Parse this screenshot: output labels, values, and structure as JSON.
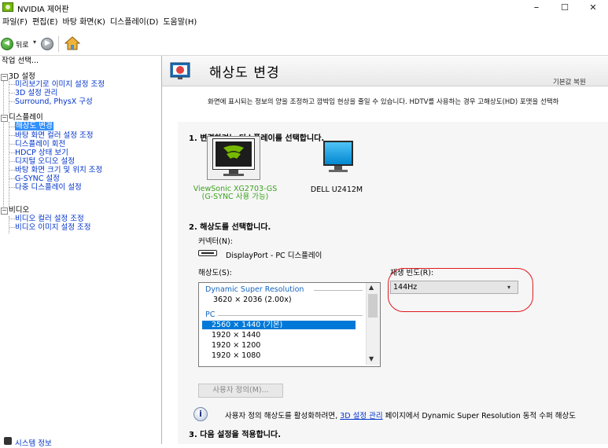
{
  "window": {
    "title": "NVIDIA 제어판",
    "minimize": "–",
    "maximize": "☐",
    "close": "✕"
  },
  "menu": [
    "파일(F)",
    "편집(E)",
    "바탕 화면(K)",
    "디스플레이(D)",
    "도움말(H)"
  ],
  "toolbar": {
    "back_label": "뒤로",
    "back_dropdown": "▾"
  },
  "sidebar": {
    "header": "작업 선택...",
    "groups": [
      {
        "label": "3D 설정",
        "items": [
          "미리보기로 이미지 설정 조정",
          "3D 설정 관리",
          "Surround, PhysX 구성"
        ]
      },
      {
        "label": "디스플레이",
        "items": [
          "해상도 변경",
          "바탕 화면 컬러 설정 조정",
          "디스플레이 회전",
          "HDCP 상태 보기",
          "디지털 오디오 설정",
          "바탕 화면 크기 및 위치 조정",
          "G-SYNC 설정",
          "다중 디스플레이 설정"
        ]
      },
      {
        "label": "비디오",
        "items": [
          "비디오 컬러 설정 조정",
          "비디오 이미지 설정 조정"
        ]
      }
    ],
    "selected": "해상도 변경",
    "system_info": "시스템 정보"
  },
  "page": {
    "title": "해상도 변경",
    "restore": "기본값 복원",
    "description": "화면에 표시되는 정보의 양을 조정하고 깜박임 현상을 줄일 수 있습니다. HDTV를 사용하는 경우 고해상도(HD) 포맷을 선택하",
    "step1": "1. 변경하려는 디스플레이를 선택합니다.",
    "monitor1_line1": "ViewSonic XG2703-GS",
    "monitor1_line2": "(G-SYNC 사용 가능)",
    "monitor2": "DELL U2412M",
    "step2": "2. 해상도를 선택합니다.",
    "connector_label": "커넥터(N):",
    "connector_value": "DisplayPort - PC 디스플레이",
    "resolution_label": "해상도(S):",
    "refresh_label": "재생 빈도(R):",
    "refresh_value": "144Hz",
    "res_groups": {
      "dsr": "Dynamic Super Resolution",
      "dsr_item": "3620 × 2036 (2.00x)",
      "pc": "PC",
      "pc_selected": "2560 × 1440 (기본)",
      "pc_items": [
        "1920 × 1440",
        "1920 × 1200",
        "1920 × 1080"
      ]
    },
    "custom_button": "사용자 정의(M)...",
    "info_prefix": "사용자 정의 해상도를 활성화하려면,",
    "info_link": "3D 설정 관리",
    "info_suffix": "페이지에서 Dynamic Super Resolution 동적 수퍼 해상도",
    "step3": "3. 다음 설정을 적용합니다."
  },
  "colors": {
    "accent_green": "#76b900",
    "link": "#0033cc",
    "selection": "#3390ff",
    "highlight_circle": "#e0191f"
  }
}
